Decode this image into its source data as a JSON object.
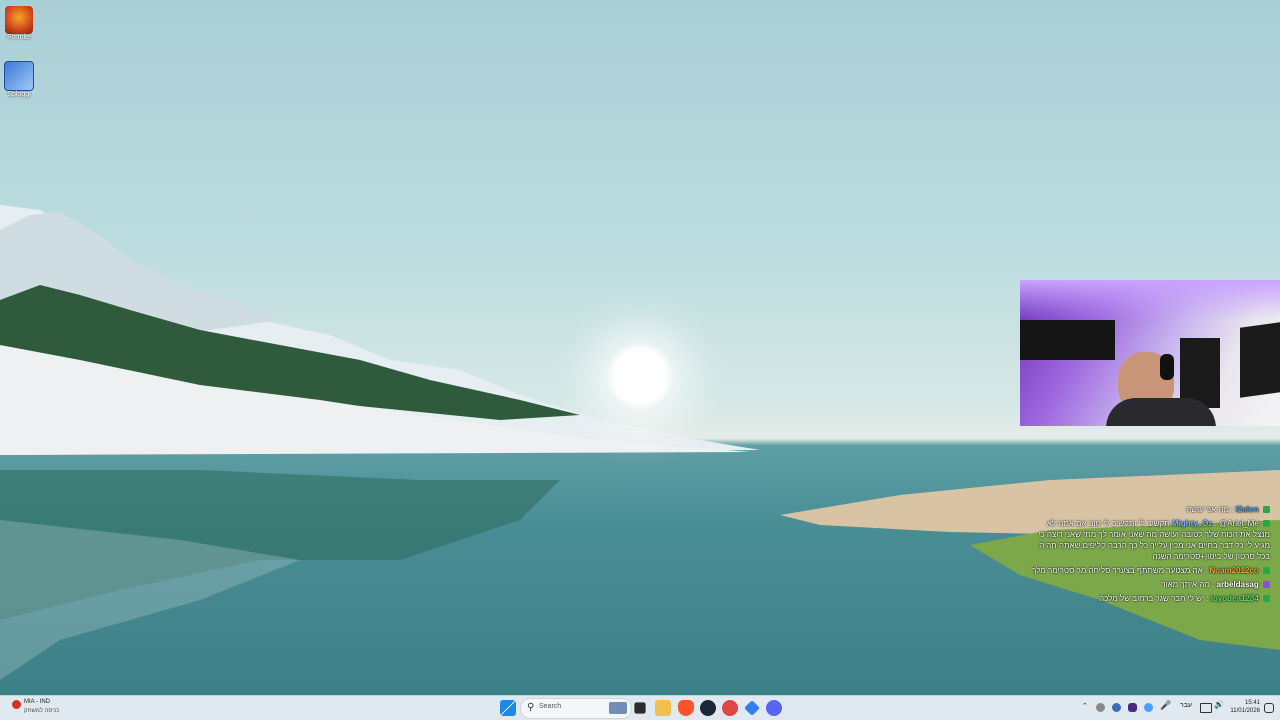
{
  "desktop": {
    "icons": [
      {
        "label": "Fortnite",
        "icon": "fortnite-icon"
      },
      {
        "label": "Sploggi",
        "icon": "app-icon"
      }
    ]
  },
  "chat": {
    "messages": [
      {
        "user": "l2alon",
        "text": "מה אני עושה",
        "color": "#4aa0ff"
      },
      {
        "user": "Mighty_Oz",
        "text": "@Ariel_Me תקשיב לי ותקשיב לי טוב אם אתה לא מנצל את הכוח שלך לטובה ועושה מה שאני אומר לך מתי שאני רוצה כי מגיע לי כל דבר בחיים אני מכין עלייך כל כך הרבה קליפים שאתה תהיה בכל סרטון של ביטון+סטרימר השנה",
        "color": "#7fb6ff"
      },
      {
        "user": "Noam2012co",
        "text": "אה מצטער משתתף בצערך סליחה מר סטרימר מלך",
        "color": "#f2a33a"
      },
      {
        "user": "arbeldasag",
        "text": "מה איתך מאור",
        "color": "#ffffff"
      },
      {
        "user": "loyodea1234",
        "text": "יש לי חבר שגר ברחוב של מלכה",
        "color": "#5be36a"
      }
    ]
  },
  "taskbar": {
    "weather_title": "MIA - IND",
    "weather_sub": "כניסה למשחק",
    "search_placeholder": "Search",
    "time": "15:41",
    "date": "11/01/2026",
    "lang": "עבר"
  }
}
